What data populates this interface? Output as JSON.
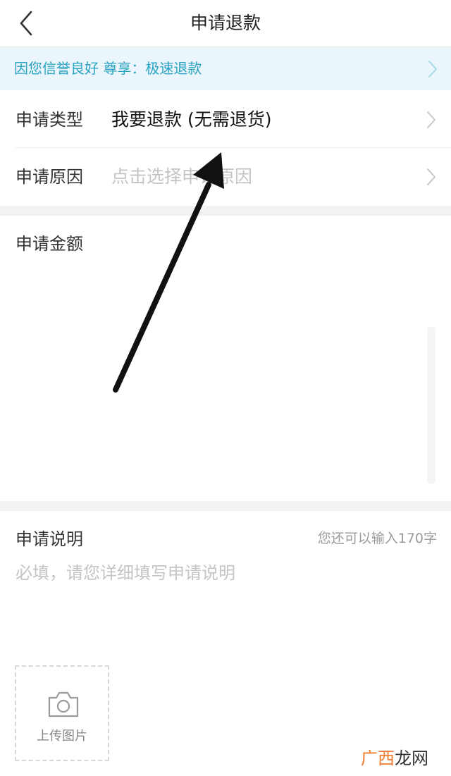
{
  "header": {
    "title": "申请退款",
    "back_icon": "chevron-left-icon"
  },
  "banner": {
    "text": "因您信誉良好 尊享：极速退款",
    "color": "#2aa3c4"
  },
  "form": {
    "type_label": "申请类型",
    "type_value": "我要退款 (无需退货)",
    "reason_label": "申请原因",
    "reason_placeholder": "点击选择申请原因",
    "amount_label": "申请金额",
    "desc_label": "申请说明",
    "desc_counter": "您还可以输入170字",
    "desc_placeholder": "必填，请您详细填写申请说明",
    "upload_label": "上传图片"
  },
  "watermark": {
    "part1": "广西",
    "part2": "龙网"
  }
}
